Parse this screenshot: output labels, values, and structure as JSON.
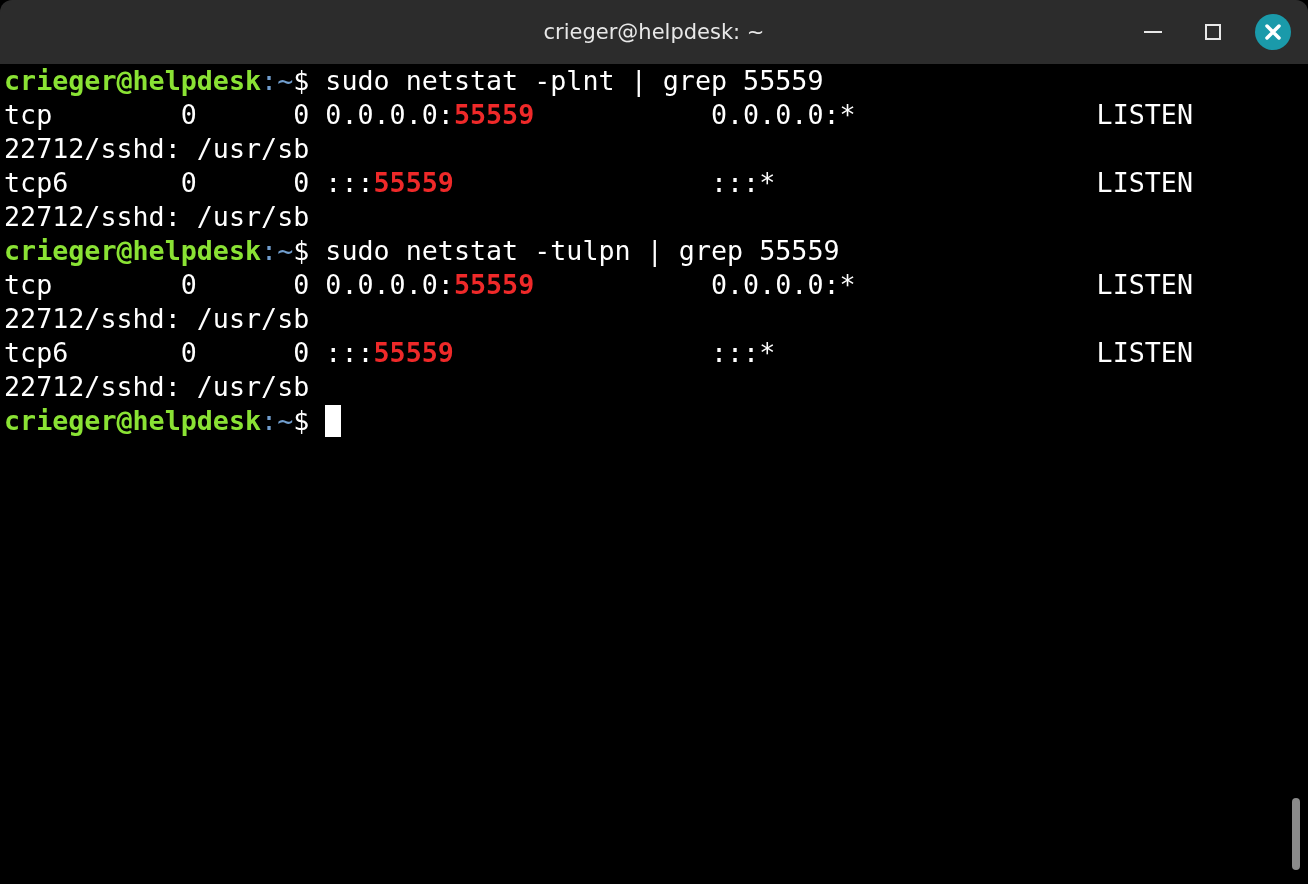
{
  "window": {
    "title": "crieger@helpdesk: ~"
  },
  "terminal": {
    "lines": [
      {
        "segments": [
          {
            "kind": "user",
            "text": "crieger@helpdesk"
          },
          {
            "kind": "path",
            "text": ":~"
          },
          {
            "kind": "plain",
            "text": "$ "
          },
          {
            "kind": "command",
            "text": "sudo netstat -plnt | grep 55559"
          }
        ]
      },
      {
        "segments": [
          {
            "kind": "plain",
            "text": "tcp        0      0 0.0.0.0:"
          },
          {
            "kind": "match",
            "text": "55559"
          },
          {
            "kind": "plain",
            "text": "           0.0.0.0:*               LISTEN"
          }
        ]
      },
      {
        "segments": [
          {
            "kind": "plain",
            "text": "22712/sshd: /usr/sb"
          }
        ]
      },
      {
        "segments": [
          {
            "kind": "plain",
            "text": "tcp6       0      0 :::"
          },
          {
            "kind": "match",
            "text": "55559"
          },
          {
            "kind": "plain",
            "text": "                :::*                    LISTEN"
          }
        ]
      },
      {
        "segments": [
          {
            "kind": "plain",
            "text": "22712/sshd: /usr/sb"
          }
        ]
      },
      {
        "segments": [
          {
            "kind": "user",
            "text": "crieger@helpdesk"
          },
          {
            "kind": "path",
            "text": ":~"
          },
          {
            "kind": "plain",
            "text": "$ "
          },
          {
            "kind": "command",
            "text": "sudo netstat -tulpn | grep 55559"
          }
        ]
      },
      {
        "segments": [
          {
            "kind": "plain",
            "text": "tcp        0      0 0.0.0.0:"
          },
          {
            "kind": "match",
            "text": "55559"
          },
          {
            "kind": "plain",
            "text": "           0.0.0.0:*               LISTEN"
          }
        ]
      },
      {
        "segments": [
          {
            "kind": "plain",
            "text": "22712/sshd: /usr/sb"
          }
        ]
      },
      {
        "segments": [
          {
            "kind": "plain",
            "text": "tcp6       0      0 :::"
          },
          {
            "kind": "match",
            "text": "55559"
          },
          {
            "kind": "plain",
            "text": "                :::*                    LISTEN"
          }
        ]
      },
      {
        "segments": [
          {
            "kind": "plain",
            "text": "22712/sshd: /usr/sb"
          }
        ]
      },
      {
        "segments": [
          {
            "kind": "user",
            "text": "crieger@helpdesk"
          },
          {
            "kind": "path",
            "text": ":~"
          },
          {
            "kind": "plain",
            "text": "$ "
          },
          {
            "kind": "cursor"
          }
        ]
      }
    ]
  }
}
